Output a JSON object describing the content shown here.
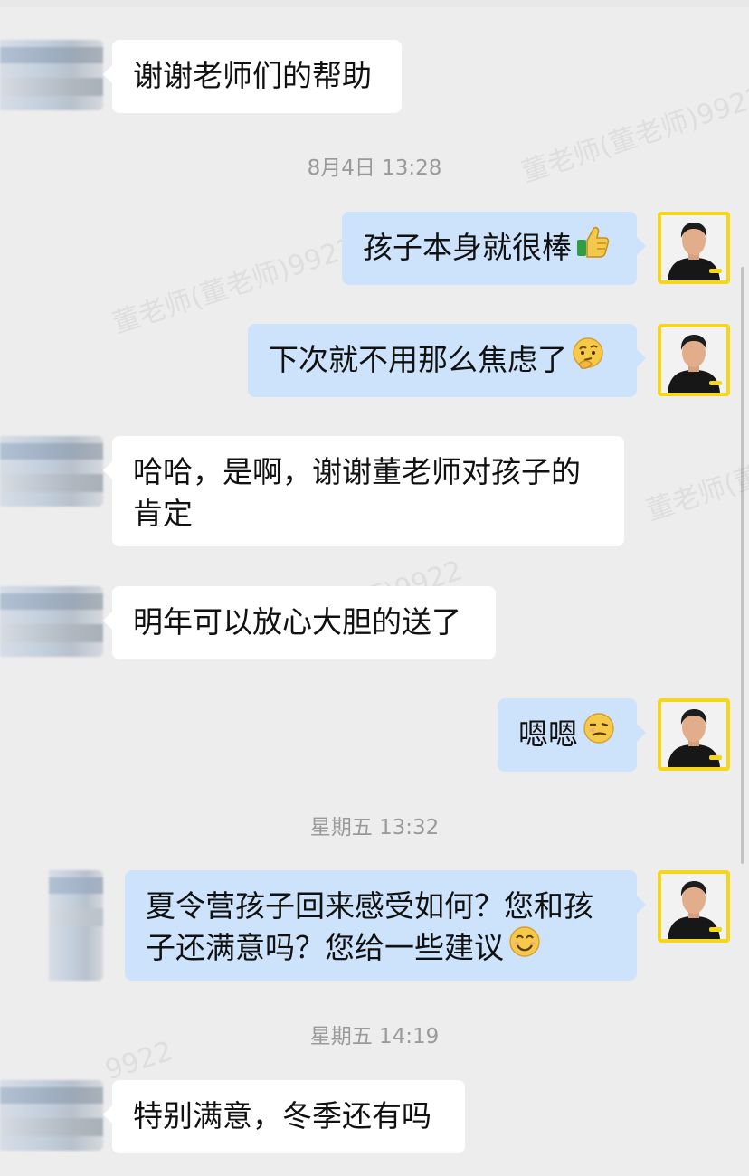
{
  "watermark": {
    "text": "董老师(董老师)9922",
    "fragment_1": "董老师(董",
    "fragment_2": "师)9922",
    "fragment_3": "9922"
  },
  "timestamps": [
    {
      "text": "8月4日 13:28"
    },
    {
      "text": "星期五 13:32"
    },
    {
      "text": "星期五 14:19"
    }
  ],
  "messages": [
    {
      "text": "谢谢老师们的帮助"
    },
    {
      "text": "孩子本身就很棒",
      "emoji": "thumbs-up-icon"
    },
    {
      "text": "下次就不用那么焦虑了",
      "emoji": "thinking-face-icon"
    },
    {
      "lines": [
        "哈哈，是啊，谢谢董老师对孩子的",
        "肯定"
      ]
    },
    {
      "text": "明年可以放心大胆的送了"
    },
    {
      "text": "嗯嗯",
      "emoji": "smirk-face-icon"
    },
    {
      "lines": [
        "夏令营孩子回来感受如何？您和孩",
        "子还满意吗？您给一些建议"
      ],
      "emoji": "smile-face-icon"
    },
    {
      "text": "特别满意，冬季还有吗"
    }
  ],
  "colors": {
    "background": "#ededed",
    "incoming_bubble": "#ffffff",
    "outgoing_bubble": "#cde3fb",
    "avatar_border": "#f4d61d",
    "timestamp": "#9a9a9a"
  }
}
